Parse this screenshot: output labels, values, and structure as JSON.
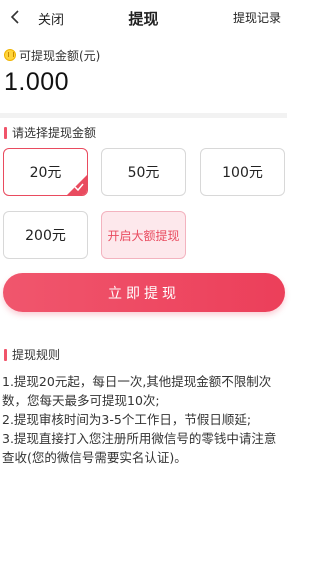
{
  "nav": {
    "close_label": "关闭",
    "title": "提现",
    "record_label": "提现记录"
  },
  "balance": {
    "label": "可提现金额(元)",
    "value": "1.000",
    "icon": "coin-icon"
  },
  "options_section": {
    "title": "请选择提现金额",
    "options": [
      {
        "label": "20元",
        "selected": true
      },
      {
        "label": "50元",
        "selected": false
      },
      {
        "label": "100元",
        "selected": false
      },
      {
        "label": "200元",
        "selected": false
      },
      {
        "label": "开启大额提现",
        "selected": false
      }
    ]
  },
  "submit_label": "立即提现",
  "rules": {
    "title": "提现规则",
    "items": [
      "1.提现20元起，每日一次,其他提现金额不限制次数，您每天最多可提现10次;",
      "2.提现审核时间为3-5个工作日，节假日顺延;",
      "3.提现直接打入您注册所用微信号的零钱中请注意查收(您的微信号需要实名认证)。"
    ]
  },
  "colors": {
    "accent": "#ec3f5a",
    "accent_light": "#fde8ec"
  }
}
